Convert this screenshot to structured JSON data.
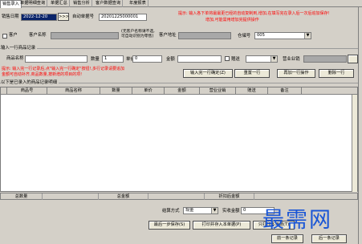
{
  "tabs": [
    "销售录入",
    "单据明细查询",
    "单据汇总",
    "销售分析",
    "客户数据查询",
    "年度报表"
  ],
  "header": {
    "doc_date_label": "销售日期",
    "doc_date_value": "2022-12-20",
    "nav_button": ">>>",
    "auto_no_label": "自动单据号",
    "auto_no_value": "20201225000001",
    "hint_top": "提示: 输入各下单将最最更已经的自动复制到,增加,在填写完在录入后一次后追加保存!",
    "hint_second": "增加,可能需用增加完提供操作",
    "customer_check_label": "客户",
    "customer_name_label": "客户名称",
    "retail_note": "(无客户名称请不选,可自动识别为零售)",
    "customer_addr_label": "客户地址",
    "warehouse_label": "仓储号",
    "warehouse_value": "005"
  },
  "entry_section": {
    "title": "输入一行商品记录",
    "product_name_label": "商品名称",
    "qty_label": "数量",
    "qty_value": "1",
    "price_label": "单价",
    "price_value": "0",
    "amount_label": "金额",
    "gift_label": "赠送",
    "ticket_label": "营业业销",
    "warning_line1": "提示: 输入完一行记录后,点\"输入完一行确定\"按钮!,多行记录请要追加",
    "warning_line2": "金额可自动补齐,商品数量,按新增的项目的项!",
    "btn_confirm_row": "输入完一行确定(Z)",
    "btn_reset_row": "重置一行",
    "btn_insert_row": "再加一行操作",
    "btn_delete_row": "删除一行"
  },
  "grid_section": {
    "title": "以下是已录入的商品记录明细",
    "columns": [
      "商品号",
      "商品名称",
      "数量",
      "单价",
      "金额",
      "营业业销",
      "赠送",
      "备注"
    ]
  },
  "totals": {
    "labels": [
      "总数量",
      "总金额",
      "折扣后金额"
    ]
  },
  "footer": {
    "settle_label": "结算方式",
    "settle_value": "现金",
    "paid_label": "实收金额",
    "paid_value": "0",
    "btn_save_print": "最后一步保存(S)",
    "btn_print_save": "打印并存入本单据(P)",
    "btn_print_again": "只打印本单据(T)",
    "btn_prev": "前一条记录",
    "btn_next": "后一条记录"
  },
  "watermark": "最需网",
  "colors": {
    "window_bg": "#d4d0c8",
    "alert_red": "#ff0000",
    "selection_blue": "#0a246a",
    "watermark_blue": "#1a56d6"
  }
}
